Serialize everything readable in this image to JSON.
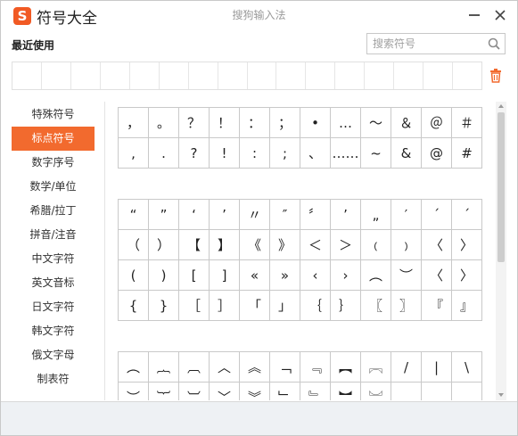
{
  "window": {
    "app_title": "符号大全",
    "center_title": "搜狗输入法",
    "logo_letter": "S"
  },
  "recent": {
    "label": "最近使用",
    "cells": 16
  },
  "search": {
    "placeholder": "搜索符号",
    "value": ""
  },
  "sidebar": {
    "items": [
      {
        "label": "特殊符号",
        "active": false
      },
      {
        "label": "标点符号",
        "active": true
      },
      {
        "label": "数字序号",
        "active": false
      },
      {
        "label": "数学/单位",
        "active": false
      },
      {
        "label": "希腊/拉丁",
        "active": false
      },
      {
        "label": "拼音/注音",
        "active": false
      },
      {
        "label": "中文字符",
        "active": false
      },
      {
        "label": "英文音标",
        "active": false
      },
      {
        "label": "日文字符",
        "active": false
      },
      {
        "label": "韩文字符",
        "active": false
      },
      {
        "label": "俄文字母",
        "active": false
      },
      {
        "label": "制表符",
        "active": false
      }
    ]
  },
  "symbols": {
    "group1": [
      [
        "，",
        "。",
        "？",
        "！",
        "：",
        "；",
        "•",
        "…",
        "～",
        "＆",
        "＠",
        "＃"
      ],
      [
        ",",
        ".",
        "?",
        "!",
        ":",
        ";",
        "、",
        "……",
        "~",
        "&",
        "@",
        "#"
      ]
    ],
    "group2": [
      [
        "“",
        "”",
        "‘",
        "’",
        "〃",
        "″",
        "〞",
        "’",
        "„",
        "′",
        "´",
        "ˊ"
      ],
      [
        "（",
        "）",
        "【",
        "】",
        "《",
        "》",
        "＜",
        "＞",
        "﹙",
        "﹚",
        "〈",
        "〉"
      ],
      [
        "(",
        ")",
        "[",
        "]",
        "«",
        "»",
        "‹",
        "›",
        "︵",
        "︶",
        "〈",
        "〉"
      ],
      [
        "{",
        "}",
        "［",
        "］",
        "「",
        "」",
        "｛",
        "｝",
        "〖",
        "〗",
        "『",
        "』"
      ]
    ],
    "group3": [
      [
        "︵",
        "︷",
        "︹",
        "︿",
        "︽",
        "﹁",
        "﹃",
        "︻",
        "︗",
        "/",
        "|",
        "\\"
      ],
      [
        "︶",
        "︸",
        "︺",
        "﹀",
        "︾",
        "﹂",
        "﹄",
        "︼",
        "︘",
        "",
        "",
        ""
      ]
    ]
  },
  "colors": {
    "accent": "#f26a2e",
    "logo": "#f15a24"
  },
  "icons": [
    "sogou-logo-icon",
    "minimize-icon",
    "close-icon",
    "search-icon",
    "trash-icon"
  ]
}
